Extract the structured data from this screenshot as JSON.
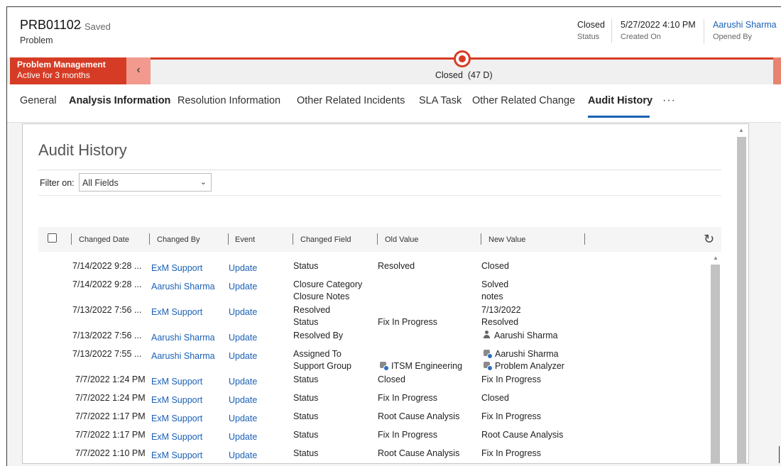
{
  "record": {
    "number": "PRB01102",
    "saved_state": "- Saved",
    "entity": "Problem",
    "fields": [
      {
        "value": "Closed",
        "label": "Status"
      },
      {
        "value": "5/27/2022 4:10 PM",
        "label": "Created On"
      },
      {
        "value": "Aarushi Sharma",
        "label": "Opened By"
      }
    ]
  },
  "bpf": {
    "process": "Problem Management",
    "active_for": "Active for 3 months",
    "current_stage": "Closed",
    "duration": "(47 D)"
  },
  "tabs": [
    {
      "label": "General"
    },
    {
      "label": "Analysis Information"
    },
    {
      "label": "Resolution Information"
    },
    {
      "label": "Other Related Incidents"
    },
    {
      "label": "SLA Task"
    },
    {
      "label": "Other Related Change"
    },
    {
      "label": "Audit History"
    },
    {
      "label": "···"
    }
  ],
  "audit": {
    "title": "Audit History",
    "filter_label": "Filter on:",
    "filter_value": "All Fields",
    "columns": [
      "Changed Date",
      "Changed By",
      "Event",
      "Changed Field",
      "Old Value",
      "New Value"
    ],
    "rows": [
      {
        "date": "7/14/2022 9:28 ...",
        "by": "ExM Support",
        "event": "Update",
        "field": [
          "Status"
        ],
        "old": [
          "Resolved"
        ],
        "new": [
          "Closed"
        ]
      },
      {
        "date": "7/14/2022 9:28 ...",
        "by": "Aarushi Sharma",
        "event": "Update",
        "field": [
          "Closure Category",
          "Closure Notes"
        ],
        "old": [
          "",
          ""
        ],
        "new": [
          "Solved",
          "notes"
        ]
      },
      {
        "date": "7/13/2022 7:56 ...",
        "by": "ExM Support",
        "event": "Update",
        "field": [
          "Resolved",
          "Status"
        ],
        "old": [
          "",
          "Fix In Progress"
        ],
        "new": [
          "7/13/2022",
          "Resolved"
        ]
      },
      {
        "date": "7/13/2022 7:56 ...",
        "by": "Aarushi Sharma",
        "event": "Update",
        "field": [
          "Resolved By"
        ],
        "old": [
          ""
        ],
        "new": [
          "Aarushi Sharma"
        ],
        "new_icon": "user-icon"
      },
      {
        "date": "7/13/2022 7:55 ...",
        "by": "Aarushi Sharma",
        "event": "Update",
        "field": [
          "Assigned To",
          "Support Group"
        ],
        "old": [
          "",
          "ITSM Engineering"
        ],
        "new": [
          "Aarushi Sharma",
          "Problem Analyzer"
        ],
        "icon": "team-icon"
      },
      {
        "date": "7/7/2022 1:24 PM",
        "by": "ExM Support",
        "event": "Update",
        "field": [
          "Status"
        ],
        "old": [
          "Closed"
        ],
        "new": [
          "Fix In Progress"
        ]
      },
      {
        "date": "7/7/2022 1:24 PM",
        "by": "ExM Support",
        "event": "Update",
        "field": [
          "Status"
        ],
        "old": [
          "Fix In Progress"
        ],
        "new": [
          "Closed"
        ]
      },
      {
        "date": "7/7/2022 1:17 PM",
        "by": "ExM Support",
        "event": "Update",
        "field": [
          "Status"
        ],
        "old": [
          "Root Cause Analysis"
        ],
        "new": [
          "Fix In Progress"
        ]
      },
      {
        "date": "7/7/2022 1:17 PM",
        "by": "ExM Support",
        "event": "Update",
        "field": [
          "Status"
        ],
        "old": [
          "Fix In Progress"
        ],
        "new": [
          "Root Cause Analysis"
        ]
      },
      {
        "date": "7/7/2022 1:10 PM",
        "by": "ExM Support",
        "event": "Update",
        "field": [
          "Status"
        ],
        "old": [
          "Root Cause Analysis"
        ],
        "new": [
          "Fix In Progress"
        ]
      }
    ]
  },
  "colors": {
    "accent": "#1a61b6",
    "stage_red": "#d63c25"
  }
}
